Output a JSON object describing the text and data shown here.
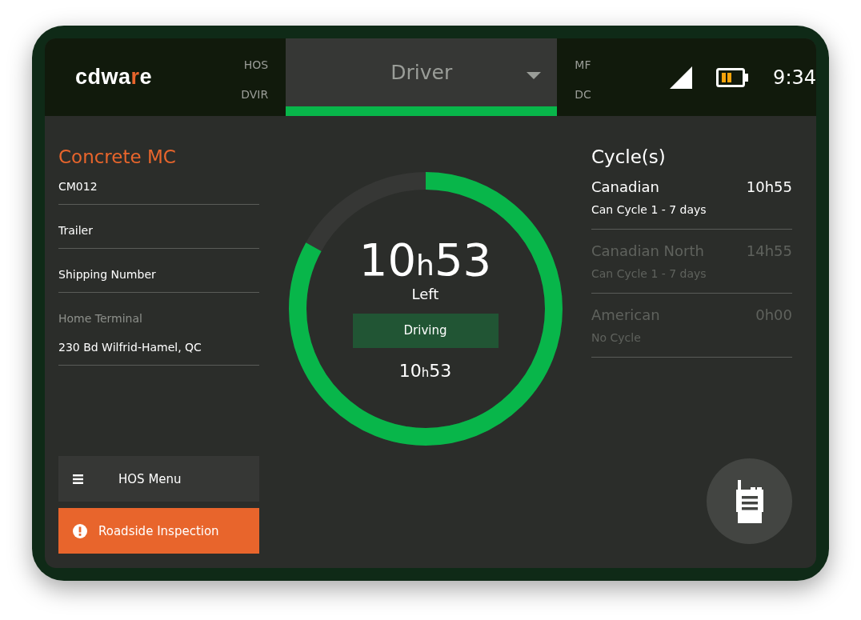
{
  "header": {
    "logo": [
      {
        "text": "cdwa",
        "accent": false
      },
      {
        "text": "r",
        "accent": true
      },
      {
        "text": "e",
        "accent": false
      }
    ],
    "left_tabs": [
      {
        "label": "HOS",
        "selected": false
      },
      {
        "label": "DVIR",
        "selected": false
      }
    ],
    "dropdown": {
      "value": "Driver",
      "selected": true
    },
    "right_tabs": [
      {
        "label": "MF",
        "selected": false
      },
      {
        "label": "DC",
        "selected": false
      }
    ],
    "time": "9:34"
  },
  "carrier": {
    "name": "Concrete MC",
    "fields": [
      {
        "value": "CM012"
      },
      {
        "value": "Trailer"
      },
      {
        "value": "Shipping Number"
      },
      {
        "label": "Home Terminal",
        "value": "230 Bd Wilfrid-Hamel, QC"
      }
    ]
  },
  "clock": {
    "level": 0.83,
    "remaining": {
      "hours": "10",
      "unit": "h",
      "minutes": "53"
    },
    "caption": "Left",
    "status": "Driving",
    "sub": {
      "hours": "10",
      "unit": "h",
      "minutes": "53"
    }
  },
  "actions": [
    {
      "label": "HOS Menu",
      "kind": "menu"
    },
    {
      "label": "Roadside Inspection",
      "kind": "alert"
    }
  ],
  "cycles": {
    "title": "Cycle(s)",
    "items": [
      {
        "name": "Canadian",
        "time": "10h55",
        "rule": "Can Cycle 1 - 7 days",
        "selected": true
      },
      {
        "name": "Canadian North",
        "time": "14h55",
        "rule": "Can Cycle 1 - 7 days",
        "selected": false
      },
      {
        "name": "American",
        "time": "0h00",
        "rule": "No Cycle",
        "selected": false
      }
    ]
  }
}
